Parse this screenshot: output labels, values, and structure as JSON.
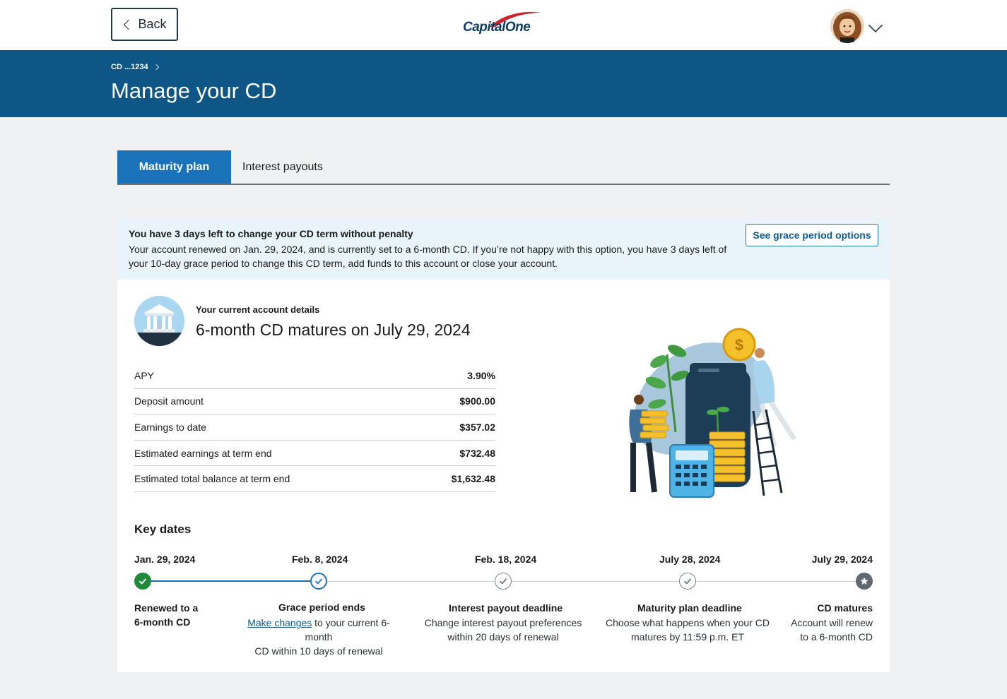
{
  "topbar": {
    "back_label": "Back",
    "logo_text": "CapitalOne"
  },
  "header": {
    "breadcrumb": "CD ...1234",
    "title": "Manage your CD"
  },
  "tabs": [
    {
      "label": "Maturity plan",
      "active": true
    },
    {
      "label": "Interest payouts",
      "active": false
    }
  ],
  "banner": {
    "title": "You have 3 days left to change your CD term without penalty",
    "body": "Your account renewed on Jan. 29, 2024, and is currently set to a 6-month CD. If you’re not happy with this option, you have 3 days left of your 10-day grace period to change this CD term, add funds to this account or close your account.",
    "button_label": "See grace period options"
  },
  "account": {
    "label": "Your current account details",
    "headline": "6-month CD matures on July 29, 2024",
    "rows": [
      {
        "label": "APY",
        "value": "3.90%"
      },
      {
        "label": "Deposit amount",
        "value": "$900.00"
      },
      {
        "label": "Earnings to date",
        "value": "$357.02"
      },
      {
        "label": "Estimated earnings at term end",
        "value": "$732.48"
      },
      {
        "label": "Estimated total balance at term end",
        "value": "$1,632.48"
      }
    ]
  },
  "key_dates": {
    "title": "Key dates",
    "items": [
      {
        "date": "Jan. 29, 2024",
        "title_line1": "Renewed to a",
        "title_line2": "6-month CD",
        "status": "complete"
      },
      {
        "date": "Feb. 8, 2024",
        "title": "Grace period ends",
        "link": "Make changes",
        "desc_after_link": " to your current 6-month",
        "desc_line2": "CD within 10 days of renewal",
        "status": "current"
      },
      {
        "date": "Feb. 18, 2024",
        "title": "Interest payout deadline",
        "desc_line1": "Change interest payout preferences",
        "desc_line2": "within 20 days of renewal",
        "status": "upcoming"
      },
      {
        "date": "July 28, 2024",
        "title": "Maturity plan deadline",
        "desc_line1": "Choose what happens when your CD",
        "desc_line2": "matures by 11:59 p.m. ET",
        "status": "upcoming"
      },
      {
        "date": "July 29, 2024",
        "title": "CD matures",
        "desc_line1": "Account will renew",
        "desc_line2": "to a 6-month CD",
        "status": "final"
      }
    ]
  },
  "colors": {
    "header_blue": "#0d5686",
    "tab_active": "#1a73ba",
    "banner_bg": "#e8f3fa",
    "complete_green": "#1e8a3a",
    "final_gray": "#5f6873"
  }
}
